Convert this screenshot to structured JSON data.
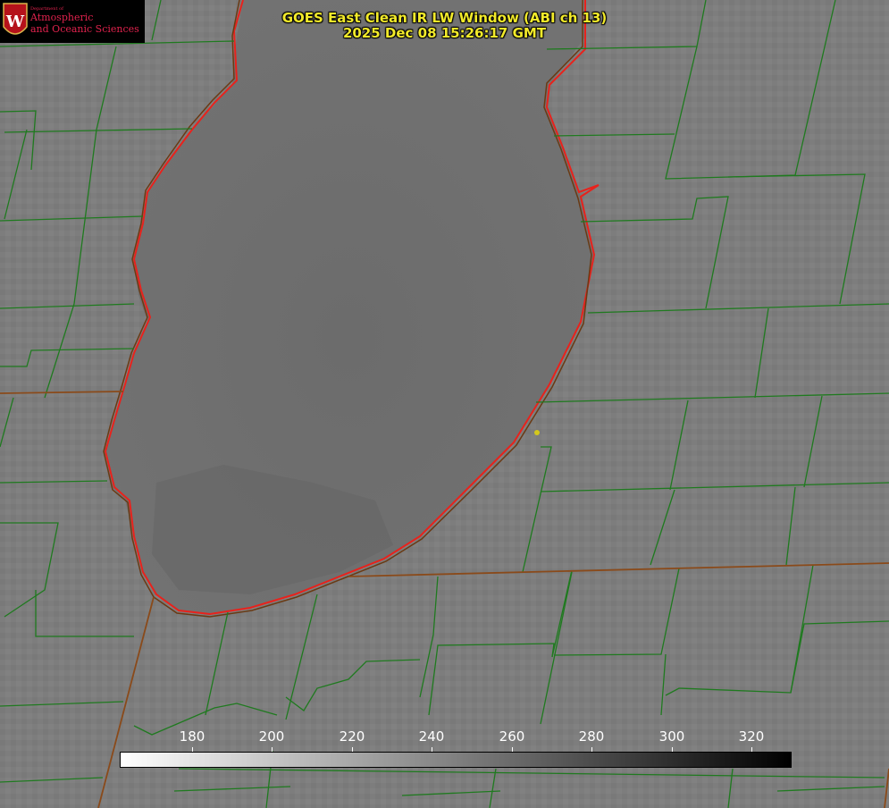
{
  "title": {
    "line1": "GOES East Clean IR LW Window (ABI ch 13)",
    "line2": "2025 Dec 08 15:26:17 GMT"
  },
  "logo": {
    "dept": "Department of",
    "line1": "Atmospheric",
    "line2": "and Oceanic Sciences",
    "emblem_letter": "W"
  },
  "colorbar": {
    "ticks": [
      "180",
      "200",
      "220",
      "240",
      "260",
      "280",
      "300",
      "320"
    ],
    "gradient": [
      "#ffffff",
      "#000000"
    ]
  },
  "colors": {
    "county_lines": "#1f7a1f",
    "state_lines": "#8a4a1a",
    "lake_outline": "#e8221c",
    "title_text": "#f2ea2a",
    "marker": "#d4c81c"
  }
}
